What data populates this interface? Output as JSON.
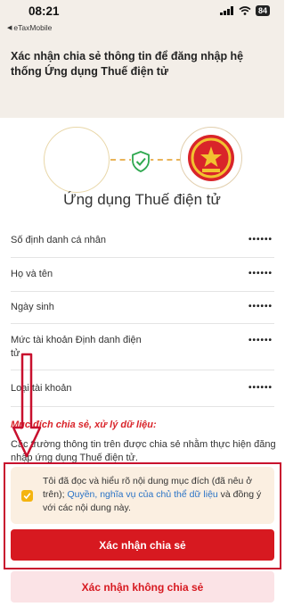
{
  "status_bar": {
    "time": "08:21",
    "battery": "84",
    "icons": [
      "signal-icon",
      "wifi-icon",
      "battery-icon"
    ]
  },
  "back": {
    "label": "eTaxMobile",
    "icon": "back-triangle-icon"
  },
  "header": {
    "title": "Xác nhận chia sẻ thông tin để đăng nhập hệ thống Ứng dụng Thuế điện tử"
  },
  "logos": {
    "left_icon": "blank-circle-logo",
    "connector_icon": "shield-check-icon",
    "right_icon": "national-emblem-icon"
  },
  "app_name": "Ứng dụng Thuế điện tử",
  "fields": [
    {
      "label": "Số định danh cá nhân",
      "value": "••••••"
    },
    {
      "label": "Họ và tên",
      "value": "••••••"
    },
    {
      "label": "Ngày sinh",
      "value": "••••••"
    },
    {
      "label": "Mức tài khoản Định danh điện tử",
      "value": "••••••"
    },
    {
      "label": "Loại tài khoản",
      "value": "••••••"
    }
  ],
  "purpose": {
    "title": "Mục đích chia sẻ, xử lý dữ liệu:",
    "text": "Các trường thông tin trên được chia sẻ nhằm thực hiện đăng nhập ứng dụng Thuế điện tử."
  },
  "consent": {
    "checked": true,
    "text_before": "Tôi đã đọc và hiểu rõ nội dung mục đích (đã nêu ở trên);",
    "link_text": "Quyền, nghĩa vụ của chủ thể dữ liệu",
    "text_after": "và đồng ý với các nội dung này."
  },
  "buttons": {
    "confirm": "Xác nhận chia sẻ",
    "decline": "Xác nhận không chia sẻ"
  },
  "colors": {
    "primary_red": "#d71920",
    "annotation_red": "#c8102e",
    "checkbox_yellow": "#f4b40f",
    "link_blue": "#2a73c6",
    "header_bg": "#f3eee8"
  }
}
